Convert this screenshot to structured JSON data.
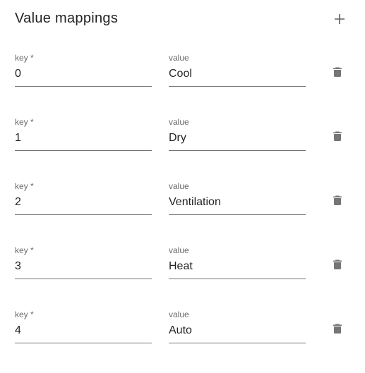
{
  "section": {
    "title": "Value mappings",
    "add_icon": "plus-icon"
  },
  "mappings": [
    {
      "key_label": "key *",
      "key": "0",
      "value_label": "value",
      "value": "Cool",
      "delete_icon": "trash-icon"
    },
    {
      "key_label": "key *",
      "key": "1",
      "value_label": "value",
      "value": "Dry",
      "delete_icon": "trash-icon"
    },
    {
      "key_label": "key *",
      "key": "2",
      "value_label": "value",
      "value": "Ventilation",
      "delete_icon": "trash-icon"
    },
    {
      "key_label": "key *",
      "key": "3",
      "value_label": "value",
      "value": "Heat",
      "delete_icon": "trash-icon"
    },
    {
      "key_label": "key *",
      "key": "4",
      "value_label": "value",
      "value": "Auto",
      "delete_icon": "trash-icon"
    }
  ],
  "colors": {
    "text": "#212121",
    "label": "#666666",
    "icon": "#757575"
  }
}
